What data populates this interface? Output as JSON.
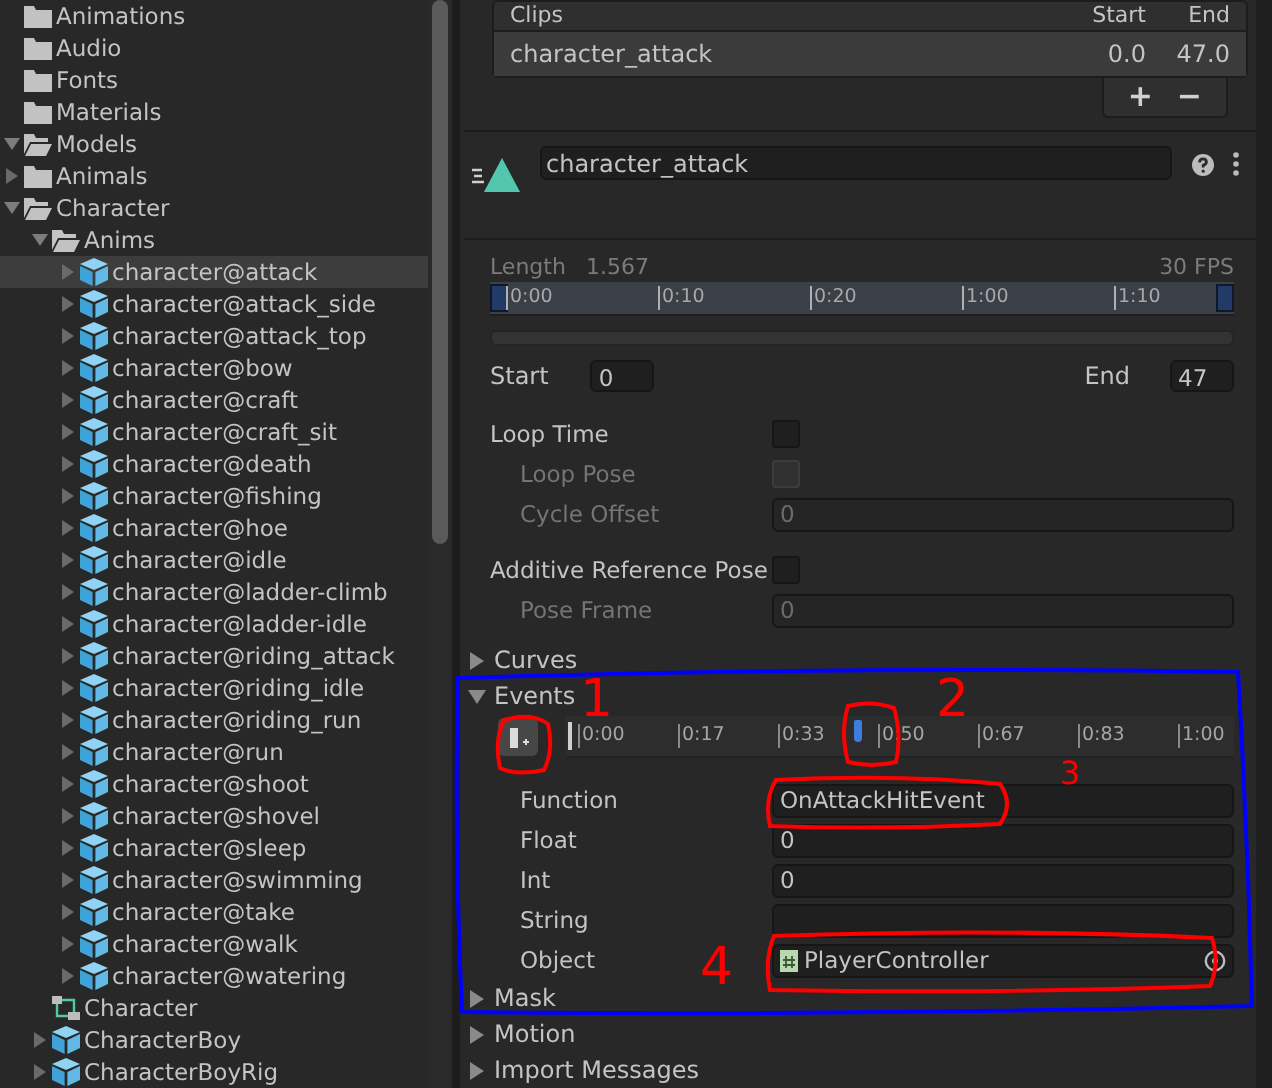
{
  "project_tree": [
    {
      "name": "Animations",
      "kind": "folder",
      "selected": false
    },
    {
      "name": "Audio",
      "kind": "folder",
      "selected": false
    },
    {
      "name": "Fonts",
      "kind": "folder",
      "selected": false
    },
    {
      "name": "Materials",
      "kind": "folder",
      "selected": false
    },
    {
      "name": "Models",
      "kind": "folder",
      "expanded": true,
      "selected": false,
      "children": [
        {
          "name": "Animals",
          "kind": "folder",
          "expanded": false,
          "selected": false
        },
        {
          "name": "Character",
          "kind": "folder",
          "expanded": true,
          "selected": false,
          "children": [
            {
              "name": "Anims",
              "kind": "folder",
              "expanded": true,
              "selected": false,
              "children": [
                {
                  "name": "character@attack",
                  "kind": "model",
                  "expanded": false,
                  "selected": true
                },
                {
                  "name": "character@attack_side",
                  "kind": "model",
                  "expanded": false,
                  "selected": false
                },
                {
                  "name": "character@attack_top",
                  "kind": "model",
                  "expanded": false,
                  "selected": false
                },
                {
                  "name": "character@bow",
                  "kind": "model",
                  "expanded": false,
                  "selected": false
                },
                {
                  "name": "character@craft",
                  "kind": "model",
                  "expanded": false,
                  "selected": false
                },
                {
                  "name": "character@craft_sit",
                  "kind": "model",
                  "expanded": false,
                  "selected": false
                },
                {
                  "name": "character@death",
                  "kind": "model",
                  "expanded": false,
                  "selected": false
                },
                {
                  "name": "character@fishing",
                  "kind": "model",
                  "expanded": false,
                  "selected": false
                },
                {
                  "name": "character@hoe",
                  "kind": "model",
                  "expanded": false,
                  "selected": false
                },
                {
                  "name": "character@idle",
                  "kind": "model",
                  "expanded": false,
                  "selected": false
                },
                {
                  "name": "character@ladder-climb",
                  "kind": "model",
                  "expanded": false,
                  "selected": false
                },
                {
                  "name": "character@ladder-idle",
                  "kind": "model",
                  "expanded": false,
                  "selected": false
                },
                {
                  "name": "character@riding_attack",
                  "kind": "model",
                  "expanded": false,
                  "selected": false
                },
                {
                  "name": "character@riding_idle",
                  "kind": "model",
                  "expanded": false,
                  "selected": false
                },
                {
                  "name": "character@riding_run",
                  "kind": "model",
                  "expanded": false,
                  "selected": false
                },
                {
                  "name": "character@run",
                  "kind": "model",
                  "expanded": false,
                  "selected": false
                },
                {
                  "name": "character@shoot",
                  "kind": "model",
                  "expanded": false,
                  "selected": false
                },
                {
                  "name": "character@shovel",
                  "kind": "model",
                  "expanded": false,
                  "selected": false
                },
                {
                  "name": "character@sleep",
                  "kind": "model",
                  "expanded": false,
                  "selected": false
                },
                {
                  "name": "character@swimming",
                  "kind": "model",
                  "expanded": false,
                  "selected": false
                },
                {
                  "name": "character@take",
                  "kind": "model",
                  "expanded": false,
                  "selected": false
                },
                {
                  "name": "character@walk",
                  "kind": "model",
                  "expanded": false,
                  "selected": false
                },
                {
                  "name": "character@watering",
                  "kind": "model",
                  "expanded": false,
                  "selected": false
                }
              ]
            },
            {
              "name": "Character",
              "kind": "controller",
              "selected": false
            },
            {
              "name": "CharacterBoy",
              "kind": "model",
              "expanded": false,
              "selected": false
            },
            {
              "name": "CharacterBoyRig",
              "kind": "model",
              "expanded": false,
              "selected": false
            }
          ]
        }
      ]
    }
  ],
  "clips": {
    "columns": [
      "Clips",
      "Start",
      "End"
    ],
    "rows": [
      {
        "name": "character_attack",
        "start": "0.0",
        "end": "47.0",
        "selected": true
      }
    ],
    "buttons": [
      "+",
      "−"
    ]
  },
  "clip": {
    "name": "character_attack",
    "length_label": "Length",
    "length": "1.567",
    "fps": "30 FPS",
    "ruler_ticks": [
      "0:00",
      "0:10",
      "0:20",
      "1:00",
      "1:10"
    ],
    "start_label": "Start",
    "start": "0",
    "end_label": "End",
    "end": "47"
  },
  "settings": [
    {
      "kind": "checkbox",
      "label": "Loop Time",
      "checked": false,
      "children": [
        {
          "kind": "checkbox",
          "label": "Loop Pose",
          "checked": false,
          "disabled": true
        },
        {
          "kind": "number",
          "label": "Cycle Offset",
          "value": "0",
          "disabled": true
        }
      ]
    },
    {
      "kind": "checkbox",
      "label": "Additive Reference Pose",
      "checked": false,
      "children": [
        {
          "kind": "number",
          "label": "Pose Frame",
          "value": "0",
          "disabled": true
        }
      ]
    }
  ],
  "sections": [
    {
      "label": "Curves",
      "expanded": false
    },
    {
      "label": "Events",
      "expanded": true,
      "timeline": {
        "ticks": [
          "0:00",
          "0:17",
          "0:33",
          "0:50",
          "0:67",
          "0:83",
          "1:00"
        ],
        "marker": {
          "level": 0.43
        }
      },
      "fields": [
        {
          "kind": "text",
          "label": "Function",
          "value": "OnAttackHitEvent"
        },
        {
          "kind": "text",
          "label": "Float",
          "value": "0"
        },
        {
          "kind": "text",
          "label": "Int",
          "value": "0"
        },
        {
          "kind": "text",
          "label": "String"
        },
        {
          "kind": "object",
          "label": "Object",
          "value": "PlayerController"
        }
      ]
    },
    {
      "label": "Mask",
      "expanded": false
    },
    {
      "label": "Motion",
      "expanded": false
    },
    {
      "label": "Import Messages",
      "expanded": false
    }
  ],
  "annotations": [
    "1",
    "2",
    "3",
    "4"
  ]
}
